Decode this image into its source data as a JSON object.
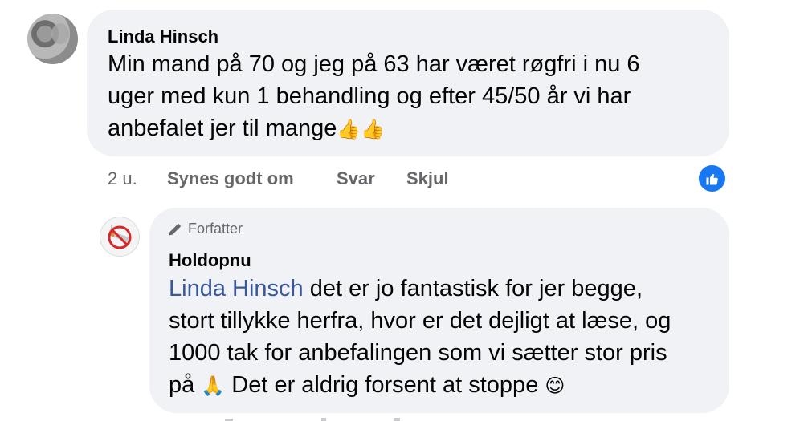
{
  "comment": {
    "author": "Linda Hinsch",
    "text_lines": [
      "Min mand på 70 og jeg på 63 har været røgfri i nu 6",
      "uger med kun 1 behandling og efter 45/50 år vi har",
      "anbefalet jer til mange"
    ],
    "emoji_tail": "👍👍",
    "time": "2 u.",
    "like_label": "Synes godt om",
    "reply_label": "Svar",
    "hide_label": "Skjul"
  },
  "reply": {
    "badge_label": "Forfatter",
    "author": "Holdopnu",
    "mention": "Linda Hinsch",
    "line1_rest": " det er jo fantastisk for jer begge,",
    "line2": "stort tillykke herfra, hvor er det dejligt at læse, og",
    "line3": "1000 tak for anbefalingen som vi sætter stor pris",
    "line4_a": "på ",
    "line4_emoji1": "🙏",
    "line4_b": " Det er aldrig forsent at stoppe ",
    "line4_emoji2": "😊"
  },
  "colors": {
    "bubble": "#f0f2f5",
    "meta_text": "#65676b",
    "mention": "#385898",
    "like_badge": "#1877f2"
  },
  "icons": {
    "like_badge": "thumbs-up-icon",
    "author_badge": "pen-icon",
    "page_avatar": "no-smoking-icon"
  }
}
